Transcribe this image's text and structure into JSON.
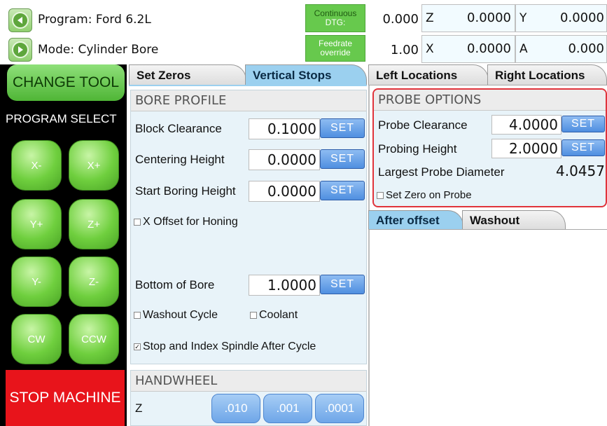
{
  "header": {
    "program_label": "Program: Ford 6.2L",
    "mode_label": "Mode: Cylinder Bore",
    "continuous_line1": "Continuous",
    "continuous_line2": "DTG:",
    "feedrate_line1": "Feedrate",
    "feedrate_line2": "override",
    "dtg_value": "0.000",
    "feedrate_value": "1.00",
    "dro": [
      {
        "axis": "Z",
        "value": "0.0000"
      },
      {
        "axis": "Y",
        "value": "0.0000"
      },
      {
        "axis": "X",
        "value": "0.0000"
      },
      {
        "axis": "A",
        "value": "0.000"
      }
    ]
  },
  "left_panel": {
    "change_tool": "CHANGE TOOL",
    "program_select": "PROGRAM SELECT",
    "jog_buttons": [
      "X-",
      "X+",
      "Y+",
      "Z+",
      "Y-",
      "Z-",
      "CW",
      "CCW"
    ],
    "stop_machine": "STOP MACHINE"
  },
  "tabs_left": [
    {
      "label": "Set Zeros",
      "active": false
    },
    {
      "label": "Vertical Stops",
      "active": true
    }
  ],
  "tabs_right": [
    {
      "label": "Left Locations",
      "active": false
    },
    {
      "label": "Right Locations",
      "active": false
    }
  ],
  "bore_profile": {
    "title": "BORE PROFILE",
    "block_clearance_label": "Block Clearance",
    "block_clearance_value": "0.1000",
    "centering_height_label": "Centering Height",
    "centering_height_value": "0.0000",
    "start_boring_label": "Start Boring Height",
    "start_boring_value": "0.0000",
    "x_offset_label": "X Offset for Honing",
    "x_offset_checked": false,
    "bottom_of_bore_label": "Bottom of Bore",
    "bottom_of_bore_value": "1.0000",
    "washout_label": "Washout Cycle",
    "washout_checked": false,
    "coolant_label": "Coolant",
    "coolant_checked": false,
    "stop_index_label": "Stop and Index Spindle After Cycle",
    "stop_index_checked": true,
    "set_label": "SET"
  },
  "handwheel": {
    "title": "HANDWHEEL",
    "axis": "Z",
    "increments": [
      ".010",
      ".001",
      ".0001"
    ]
  },
  "probe_options": {
    "title": "PROBE OPTIONS",
    "probe_clearance_label": "Probe Clearance",
    "probe_clearance_value": "4.0000",
    "probing_height_label": "Probing Height",
    "probing_height_value": "2.0000",
    "largest_diameter_label": "Largest Probe Diameter",
    "largest_diameter_value": "4.0457",
    "set_zero_label": "Set Zero on Probe",
    "set_zero_checked": false,
    "set_label": "SET"
  },
  "sub_tabs": [
    {
      "label": "After offset",
      "active": true
    },
    {
      "label": "Washout",
      "active": false
    }
  ],
  "colors": {
    "accent_green": "#67c94d",
    "stop_red": "#e8141b",
    "set_blue": "#4f8fe0",
    "active_tab": "#9bd0ef",
    "probe_border": "#e0333b"
  }
}
